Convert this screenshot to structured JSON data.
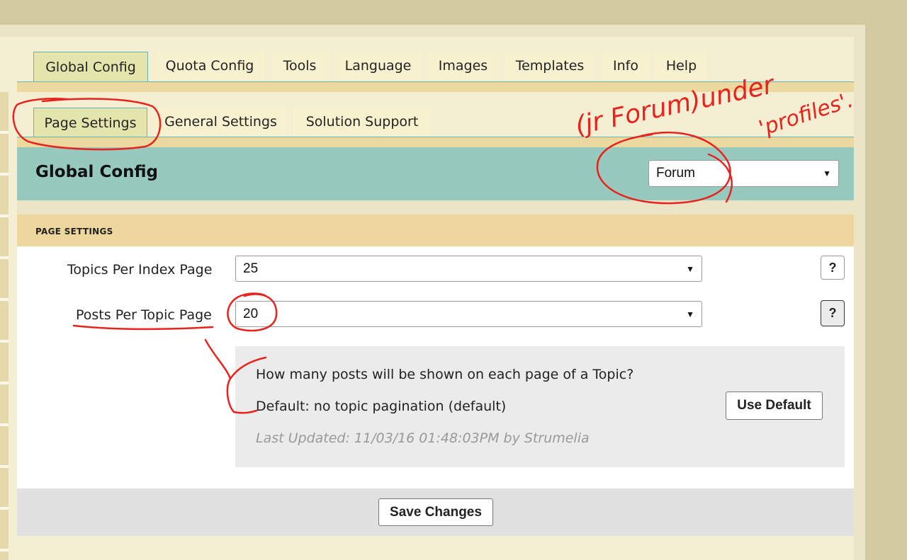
{
  "main_tabs": [
    "Global Config",
    "Quota Config",
    "Tools",
    "Language",
    "Images",
    "Templates",
    "Info",
    "Help"
  ],
  "sub_tabs": [
    "Page Settings",
    "General Settings",
    "Solution Support"
  ],
  "header": {
    "title": "Global Config",
    "module_select": "Forum"
  },
  "section": {
    "title": "PAGE SETTINGS"
  },
  "settings": {
    "topics_label": "Topics Per Index Page",
    "topics_value": "25",
    "posts_label": "Posts Per Topic Page",
    "posts_value": "20",
    "help_icon": "?"
  },
  "help_box": {
    "question": "How many posts will be shown on each page of a Topic?",
    "default_text": "Default: no topic pagination (default)",
    "last_updated": "Last Updated: 11/03/16 01:48:03PM by Strumelia",
    "use_default_label": "Use Default"
  },
  "footer": {
    "save_label": "Save Changes"
  },
  "annotation": {
    "line1": "(jr Forum)under",
    "line2": "'profiles'."
  },
  "colors": {
    "header_bg": "#98c9be",
    "section_bg": "#eed79e",
    "annotation": "#e8231e"
  }
}
